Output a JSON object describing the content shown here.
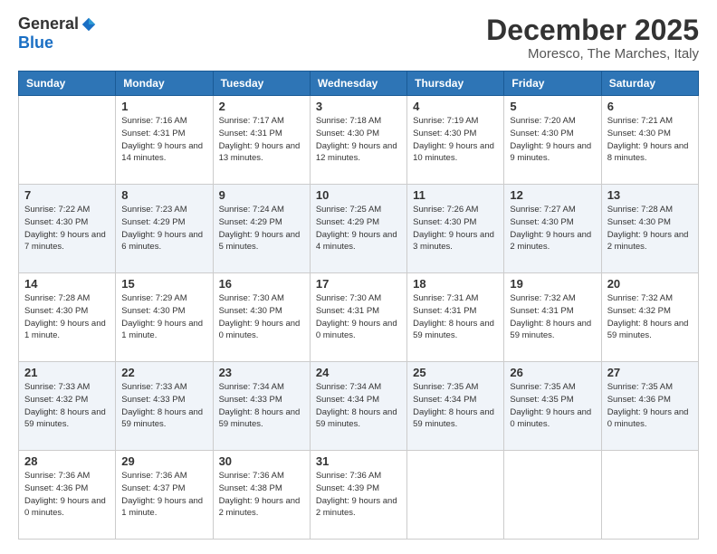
{
  "logo": {
    "general": "General",
    "blue": "Blue"
  },
  "header": {
    "month": "December 2025",
    "location": "Moresco, The Marches, Italy"
  },
  "days_of_week": [
    "Sunday",
    "Monday",
    "Tuesday",
    "Wednesday",
    "Thursday",
    "Friday",
    "Saturday"
  ],
  "weeks": [
    [
      {
        "day": "",
        "info": ""
      },
      {
        "day": "1",
        "info": "Sunrise: 7:16 AM\nSunset: 4:31 PM\nDaylight: 9 hours\nand 14 minutes."
      },
      {
        "day": "2",
        "info": "Sunrise: 7:17 AM\nSunset: 4:31 PM\nDaylight: 9 hours\nand 13 minutes."
      },
      {
        "day": "3",
        "info": "Sunrise: 7:18 AM\nSunset: 4:30 PM\nDaylight: 9 hours\nand 12 minutes."
      },
      {
        "day": "4",
        "info": "Sunrise: 7:19 AM\nSunset: 4:30 PM\nDaylight: 9 hours\nand 10 minutes."
      },
      {
        "day": "5",
        "info": "Sunrise: 7:20 AM\nSunset: 4:30 PM\nDaylight: 9 hours\nand 9 minutes."
      },
      {
        "day": "6",
        "info": "Sunrise: 7:21 AM\nSunset: 4:30 PM\nDaylight: 9 hours\nand 8 minutes."
      }
    ],
    [
      {
        "day": "7",
        "info": "Sunrise: 7:22 AM\nSunset: 4:30 PM\nDaylight: 9 hours\nand 7 minutes."
      },
      {
        "day": "8",
        "info": "Sunrise: 7:23 AM\nSunset: 4:29 PM\nDaylight: 9 hours\nand 6 minutes."
      },
      {
        "day": "9",
        "info": "Sunrise: 7:24 AM\nSunset: 4:29 PM\nDaylight: 9 hours\nand 5 minutes."
      },
      {
        "day": "10",
        "info": "Sunrise: 7:25 AM\nSunset: 4:29 PM\nDaylight: 9 hours\nand 4 minutes."
      },
      {
        "day": "11",
        "info": "Sunrise: 7:26 AM\nSunset: 4:30 PM\nDaylight: 9 hours\nand 3 minutes."
      },
      {
        "day": "12",
        "info": "Sunrise: 7:27 AM\nSunset: 4:30 PM\nDaylight: 9 hours\nand 2 minutes."
      },
      {
        "day": "13",
        "info": "Sunrise: 7:28 AM\nSunset: 4:30 PM\nDaylight: 9 hours\nand 2 minutes."
      }
    ],
    [
      {
        "day": "14",
        "info": "Sunrise: 7:28 AM\nSunset: 4:30 PM\nDaylight: 9 hours\nand 1 minute."
      },
      {
        "day": "15",
        "info": "Sunrise: 7:29 AM\nSunset: 4:30 PM\nDaylight: 9 hours\nand 1 minute."
      },
      {
        "day": "16",
        "info": "Sunrise: 7:30 AM\nSunset: 4:30 PM\nDaylight: 9 hours\nand 0 minutes."
      },
      {
        "day": "17",
        "info": "Sunrise: 7:30 AM\nSunset: 4:31 PM\nDaylight: 9 hours\nand 0 minutes."
      },
      {
        "day": "18",
        "info": "Sunrise: 7:31 AM\nSunset: 4:31 PM\nDaylight: 8 hours\nand 59 minutes."
      },
      {
        "day": "19",
        "info": "Sunrise: 7:32 AM\nSunset: 4:31 PM\nDaylight: 8 hours\nand 59 minutes."
      },
      {
        "day": "20",
        "info": "Sunrise: 7:32 AM\nSunset: 4:32 PM\nDaylight: 8 hours\nand 59 minutes."
      }
    ],
    [
      {
        "day": "21",
        "info": "Sunrise: 7:33 AM\nSunset: 4:32 PM\nDaylight: 8 hours\nand 59 minutes."
      },
      {
        "day": "22",
        "info": "Sunrise: 7:33 AM\nSunset: 4:33 PM\nDaylight: 8 hours\nand 59 minutes."
      },
      {
        "day": "23",
        "info": "Sunrise: 7:34 AM\nSunset: 4:33 PM\nDaylight: 8 hours\nand 59 minutes."
      },
      {
        "day": "24",
        "info": "Sunrise: 7:34 AM\nSunset: 4:34 PM\nDaylight: 8 hours\nand 59 minutes."
      },
      {
        "day": "25",
        "info": "Sunrise: 7:35 AM\nSunset: 4:34 PM\nDaylight: 8 hours\nand 59 minutes."
      },
      {
        "day": "26",
        "info": "Sunrise: 7:35 AM\nSunset: 4:35 PM\nDaylight: 9 hours\nand 0 minutes."
      },
      {
        "day": "27",
        "info": "Sunrise: 7:35 AM\nSunset: 4:36 PM\nDaylight: 9 hours\nand 0 minutes."
      }
    ],
    [
      {
        "day": "28",
        "info": "Sunrise: 7:36 AM\nSunset: 4:36 PM\nDaylight: 9 hours\nand 0 minutes."
      },
      {
        "day": "29",
        "info": "Sunrise: 7:36 AM\nSunset: 4:37 PM\nDaylight: 9 hours\nand 1 minute."
      },
      {
        "day": "30",
        "info": "Sunrise: 7:36 AM\nSunset: 4:38 PM\nDaylight: 9 hours\nand 2 minutes."
      },
      {
        "day": "31",
        "info": "Sunrise: 7:36 AM\nSunset: 4:39 PM\nDaylight: 9 hours\nand 2 minutes."
      },
      {
        "day": "",
        "info": ""
      },
      {
        "day": "",
        "info": ""
      },
      {
        "day": "",
        "info": ""
      }
    ]
  ]
}
